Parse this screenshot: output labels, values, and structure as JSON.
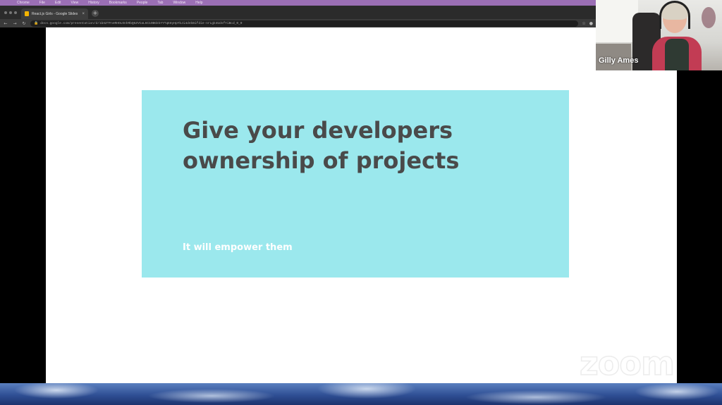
{
  "menubar": {
    "items": [
      "Chrome",
      "File",
      "Edit",
      "View",
      "History",
      "Bookmarks",
      "People",
      "Tab",
      "Window",
      "Help"
    ]
  },
  "browser": {
    "tab_title": "React.js Girls - Google Slides",
    "tab_close": "×",
    "new_tab": "+",
    "url": "docs.google.com/presentation/d/1bXZTFneRHOLOnhRbQ6ZVCaL6C1OBGkkYYTqE8yHpYbJi4d4kBifdie-nrLgk4UdsfYiBcd_0_0"
  },
  "slide": {
    "headline": "Give your developers ownership of projects",
    "subtitle": "It will empower them"
  },
  "video": {
    "participant_name": "Gilly Ames"
  },
  "watermark": {
    "text": "zoom"
  },
  "colors": {
    "callout_bg": "#9be8ed",
    "headline": "#4a4a4a",
    "menubar": "#9b6fb5"
  }
}
